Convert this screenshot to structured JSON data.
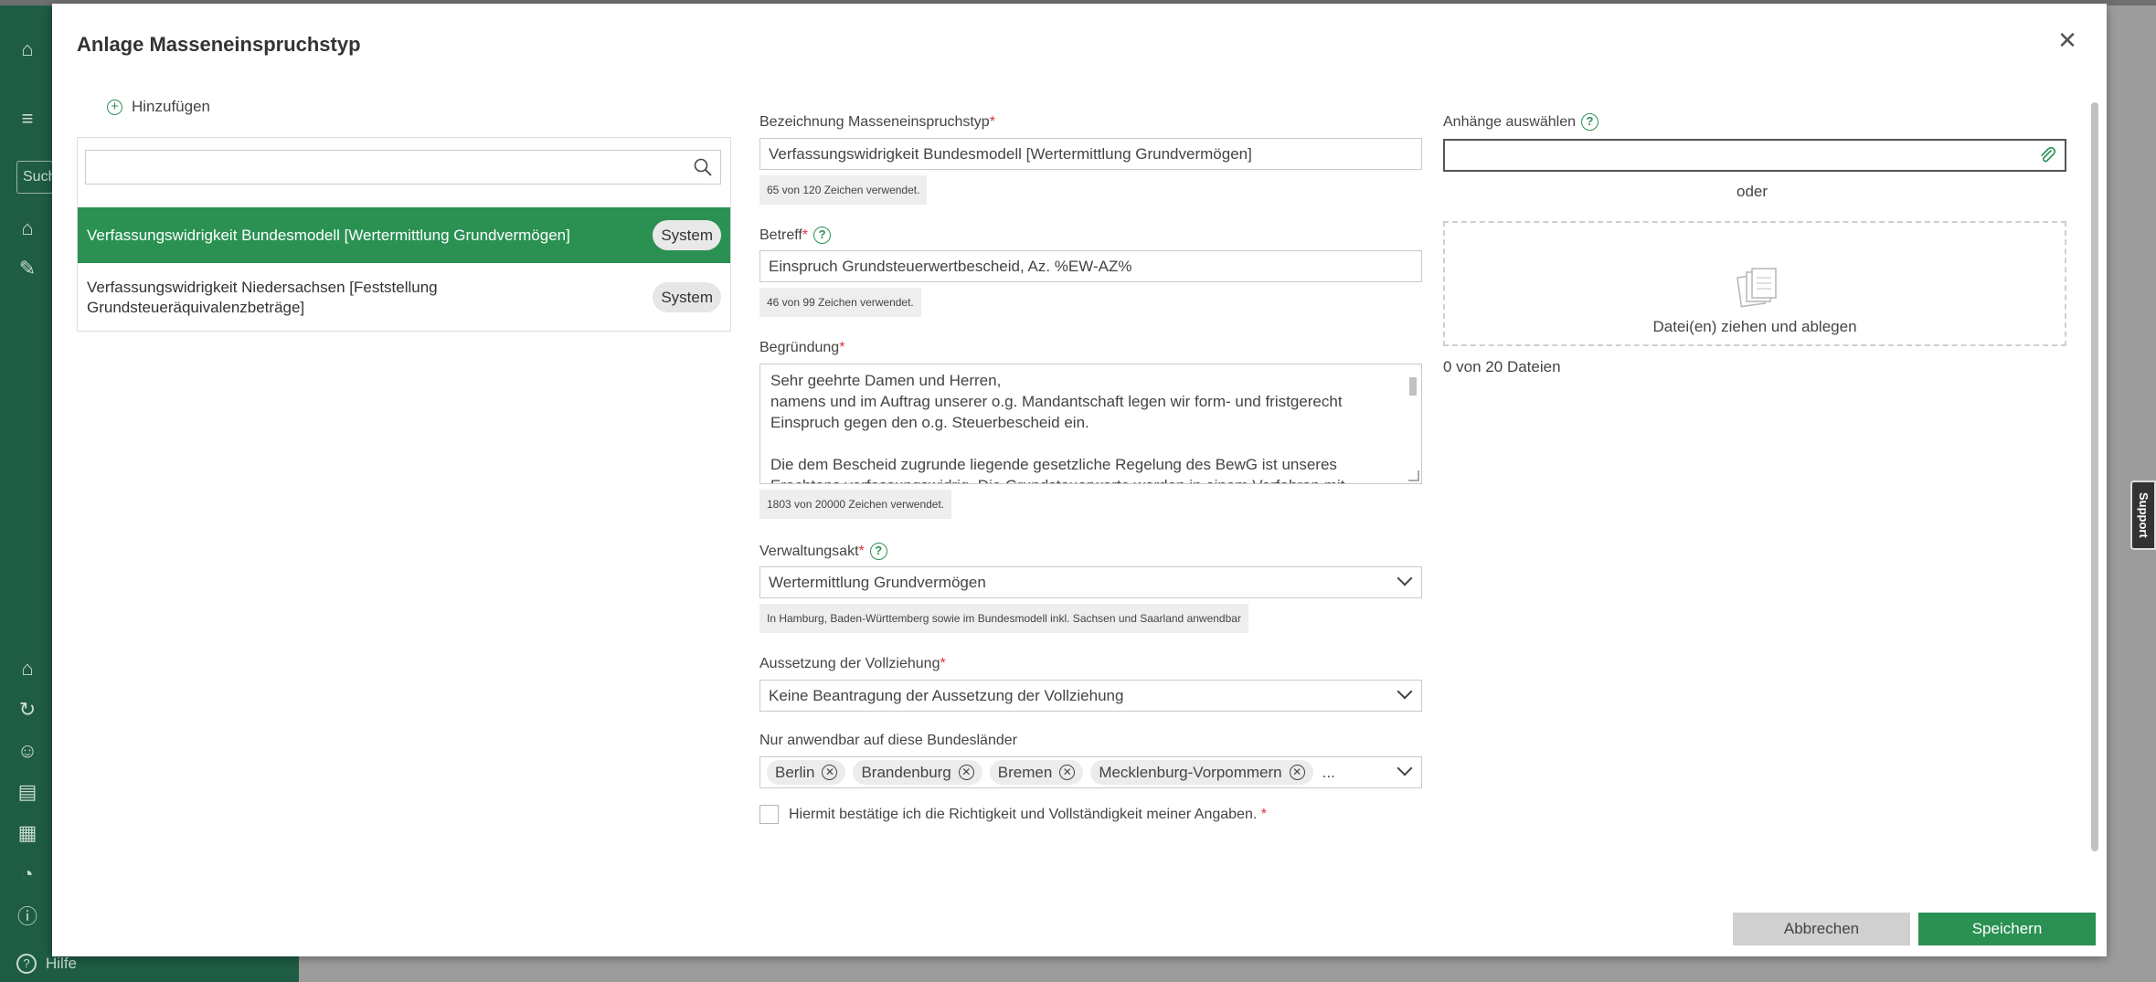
{
  "app": {
    "search_placeholder": "Such",
    "help_label": "Hilfe",
    "support_label": "Support"
  },
  "modal": {
    "title": "Anlage Masseneinspruchstyp",
    "add_label": "Hinzufügen",
    "list_search_placeholder": "",
    "list_items": [
      {
        "label": "Verfassungswidrigkeit Bundesmodell [Wertermittlung Grundvermögen]",
        "badge": "System"
      },
      {
        "label": "Verfassungswidrigkeit Niedersachsen [Feststellung Grundsteueräquivalenzbeträge]",
        "badge": "System"
      }
    ],
    "bezeichnung": {
      "label": "Bezeichnung Masseneinspruchstyp",
      "required": "*",
      "value": "Verfassungswidrigkeit Bundesmodell [Wertermittlung Grundvermögen]",
      "counter": "65 von 120 Zeichen verwendet."
    },
    "betreff": {
      "label": "Betreff",
      "required": "*",
      "help": "?",
      "value": "Einspruch Grundsteuerwertbescheid, Az. %EW-AZ%",
      "counter": "46 von 99 Zeichen verwendet."
    },
    "begruendung": {
      "label": "Begründung",
      "required": "*",
      "value": "Sehr geehrte Damen und Herren,\nnamens und im Auftrag unserer o.g. Mandantschaft legen wir form- und fristgerecht Einspruch gegen den o.g. Steuerbescheid ein.\n\nDie dem Bescheid zugrunde liegende gesetzliche Regelung des BewG ist unseres Erachtens verfassungswidrig. Die Grundsteuerwerte werden in einem Verfahren mit",
      "counter": "1803 von 20000 Zeichen verwendet."
    },
    "verwaltungsakt": {
      "label": "Verwaltungsakt",
      "required": "*",
      "help": "?",
      "value": "Wertermittlung Grundvermögen",
      "hint": "In Hamburg, Baden-Württemberg sowie im Bundesmodell inkl. Sachsen und Saarland anwendbar"
    },
    "aussetzung": {
      "label": "Aussetzung der Vollziehung",
      "required": "*",
      "value": "Keine Beantragung der Aussetzung der Vollziehung"
    },
    "bundeslaender": {
      "label": "Nur anwendbar auf diese Bundesländer",
      "chips": [
        "Berlin",
        "Brandenburg",
        "Bremen",
        "Mecklenburg-Vorpommern"
      ],
      "more": "..."
    },
    "confirm": {
      "label": "Hiermit bestätige ich die Richtigkeit und Vollständigkeit meiner Angaben.",
      "required": "*",
      "checked": false
    },
    "attachments": {
      "label": "Anhänge auswählen",
      "help": "?",
      "or": "oder",
      "drop_text": "Datei(en) ziehen und ablegen",
      "count": "0 von 20 Dateien"
    },
    "cancel_label": "Abbrechen",
    "save_label": "Speichern"
  },
  "colors": {
    "accent": "#2a9153",
    "required": "#d9343a",
    "sidebar": "#1f5c44"
  }
}
